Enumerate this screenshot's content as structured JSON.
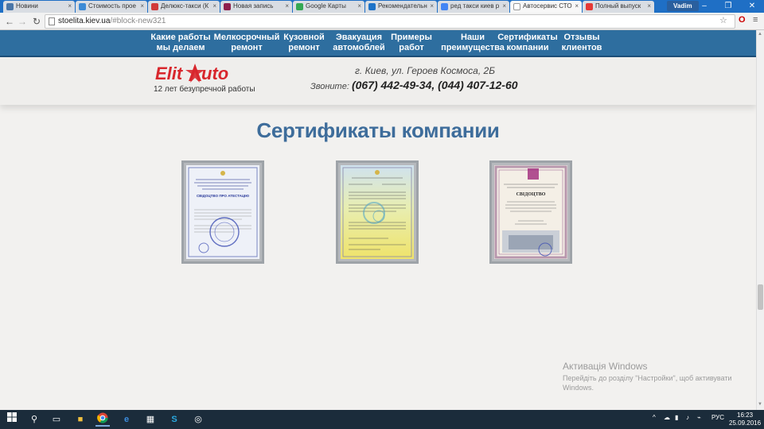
{
  "browser": {
    "tabs": [
      {
        "title": "Новини",
        "color": "#4a76a8",
        "active": false
      },
      {
        "title": "Стоимость прое",
        "color": "#3d8bd6",
        "active": false
      },
      {
        "title": "Делюкс-такси (К",
        "color": "#d13a3a",
        "active": false
      },
      {
        "title": "Новая запись",
        "color": "#8e1f4d",
        "active": false
      },
      {
        "title": "Google Карты",
        "color": "#34a853",
        "active": false
      },
      {
        "title": "Рекомендательн",
        "color": "#1e73c8",
        "active": false
      },
      {
        "title": "ред такси киев р",
        "color": "#4285f4",
        "active": false
      },
      {
        "title": "Автосервис СТО",
        "color": "#ffffff",
        "active": true
      },
      {
        "title": "Полный выпуск",
        "color": "#e53935",
        "active": false
      }
    ],
    "profile": "Vadim",
    "url_host": "stoelita.kiev.ua",
    "url_path": "/#block-new321"
  },
  "nav": {
    "items": [
      {
        "label": "Какие работы мы делаем",
        "l1": "Какие работы",
        "l2": "мы делаем"
      },
      {
        "label": "Мелкосрочный ремонт",
        "l1": "Мелкосрочный",
        "l2": "ремонт"
      },
      {
        "label": "Кузовной ремонт",
        "l1": "Кузовной",
        "l2": "ремонт"
      },
      {
        "label": "Эвакуация автомоблей",
        "l1": "Эвакуация",
        "l2": "автомоблей"
      },
      {
        "label": "Примеры работ",
        "l1": "Примеры",
        "l2": "работ"
      },
      {
        "label": "Наши преимущества",
        "l1": "Наши",
        "l2": "преимущества"
      },
      {
        "label": "Сертификаты компании",
        "l1": "Сертификаты",
        "l2": "компании"
      },
      {
        "label": "Отзывы клиентов",
        "l1": "Отзывы",
        "l2": "клиентов"
      }
    ]
  },
  "header": {
    "logo_text": "EliteAuto",
    "tagline": "12 лет безупречной работы",
    "address": "г. Киев, ул. Героев Космоса, 2Б",
    "call_label": "Звоните:",
    "phones": "(067) 442-49-34, (044) 407-12-60"
  },
  "section": {
    "title": "Сертификаты компании",
    "certificates": [
      {
        "caption": "СВІДОЦТВО ПРО АТЕСТАЦІЮ",
        "tone": "#eef1f8"
      },
      {
        "caption": "",
        "tone": "#e6eeb0"
      },
      {
        "caption": "СВІДОЦТВО",
        "tone": "#f4efe6"
      }
    ]
  },
  "os": {
    "activation_title": "Активація Windows",
    "activation_text": "Перейдіть до розділу \"Настройки\", щоб активувати Windows.",
    "lang": "РУС",
    "time": "16:23",
    "date": "25.09.2016"
  },
  "colors": {
    "nav_bg": "#2e6e9f",
    "title": "#3e6d9b",
    "logo_red": "#d8272d",
    "taskbar": "#1b2c3b"
  }
}
